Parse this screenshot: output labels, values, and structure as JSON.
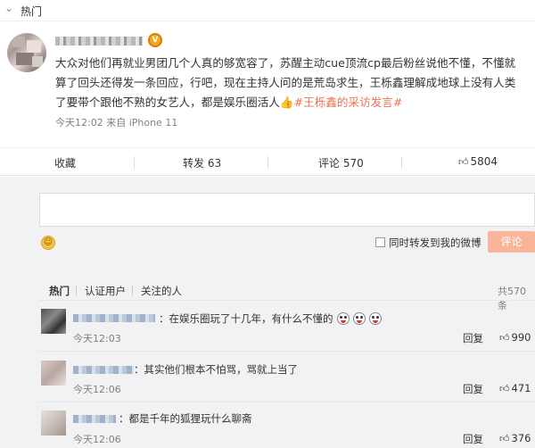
{
  "header": {
    "chevron_icon": "chevron-down-icon",
    "label": "热门"
  },
  "post": {
    "avatar_icon": "blurred-avatar",
    "verified_badge": "V",
    "text": "大众对他们再就业男团几个人真的够宽容了，苏醒主动cue顶流cp最后粉丝说他不懂，不懂就算了回头还得发一条回应，行吧，现在主持人问的是荒岛求生，王栎鑫理解成地球上没有人类了要带个跟他不熟的女艺人，都是娱乐圈活人",
    "thumb_emoji": "👍",
    "hashtag": "#王栎鑫的采访发言#",
    "meta": "今天12:02 来自 iPhone 11"
  },
  "actions": {
    "favorite": "收藏",
    "repost": "转发 63",
    "comment": "评论 570",
    "like": "5804",
    "like_icon": "thumb-up-icon"
  },
  "comment_box": {
    "emoji_icon": "smile-icon",
    "also_repost_label": "同时转发到我的微博",
    "submit_label": "评论"
  },
  "comment_tabs": {
    "hot": "热门",
    "verified": "认证用户",
    "following": "关注的人",
    "total": "共570条"
  },
  "comments": [
    {
      "text": "：在娱乐圈玩了十几年，有什么不懂的",
      "emojis": 3,
      "time": "今天12:03",
      "reply": "回复",
      "likes": "990"
    },
    {
      "text": "：其实他们根本不怕骂，骂就上当了",
      "emojis": 0,
      "time": "今天12:06",
      "reply": "回复",
      "likes": "471"
    },
    {
      "text": "：都是千年的狐狸玩什么聊斋",
      "emojis": 0,
      "time": "今天12:06",
      "reply": "回复",
      "likes": "376"
    }
  ],
  "colors": {
    "accent": "#eb7350",
    "submit_bg": "#f8b598",
    "area_bg": "#f2f2f5",
    "verified": "#f5a623"
  }
}
